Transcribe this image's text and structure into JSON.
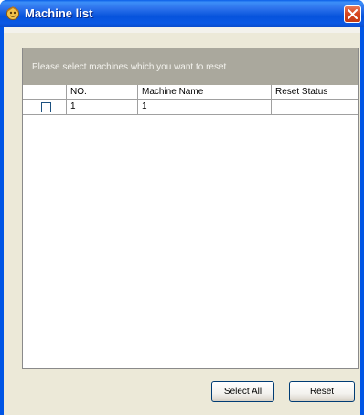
{
  "window": {
    "title": "Machine list",
    "close_symbol": "×"
  },
  "grid": {
    "caption": "Please select machines which you want to reset",
    "columns": [
      "",
      "NO.",
      "Machine Name",
      "Reset Status"
    ],
    "rows": [
      {
        "checked": false,
        "no": "1",
        "machine_name": "1",
        "reset_status": ""
      }
    ]
  },
  "buttons": {
    "select_all": "Select All",
    "reset": "Reset"
  },
  "colors": {
    "titlebar": "#0a58e4",
    "close_button": "#d8461e",
    "client_bg": "#ece9d8",
    "caption_bg": "#aaa89d",
    "caption_text": "#f4f3ee"
  },
  "icons": {
    "title_icon": "app-icon",
    "close_icon": "close-icon"
  }
}
